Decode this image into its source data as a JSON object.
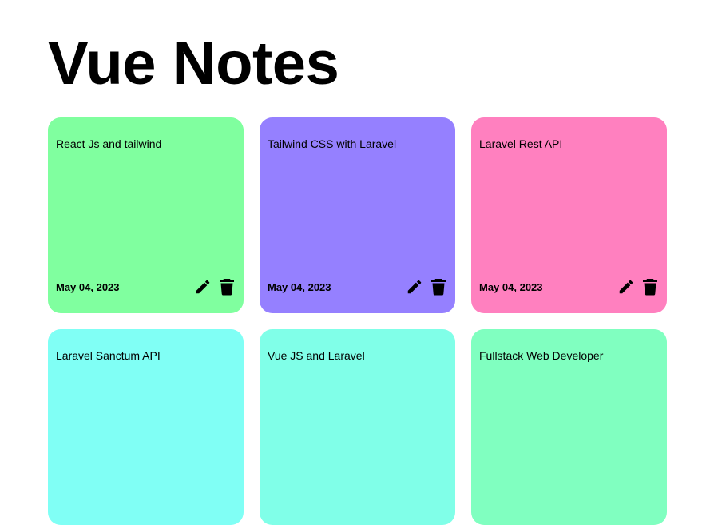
{
  "app": {
    "title": "Vue Notes"
  },
  "notes": [
    {
      "text": "React Js and tailwind",
      "date": "May 04, 2023",
      "color": "#80ff9f"
    },
    {
      "text": "Tailwind CSS with Laravel",
      "date": "May 04, 2023",
      "color": "#9580ff"
    },
    {
      "text": "Laravel Rest API",
      "date": "May 04, 2023",
      "color": "#ff80bf"
    },
    {
      "text": "Laravel Sanctum API",
      "date": "",
      "color": "#80fff5"
    },
    {
      "text": "Vue JS and Laravel",
      "date": "",
      "color": "#80ffe8"
    },
    {
      "text": "Fullstack Web Developer",
      "date": "",
      "color": "#80ffc0"
    }
  ],
  "icons": {
    "edit": "pencil-icon",
    "delete": "trash-icon"
  }
}
